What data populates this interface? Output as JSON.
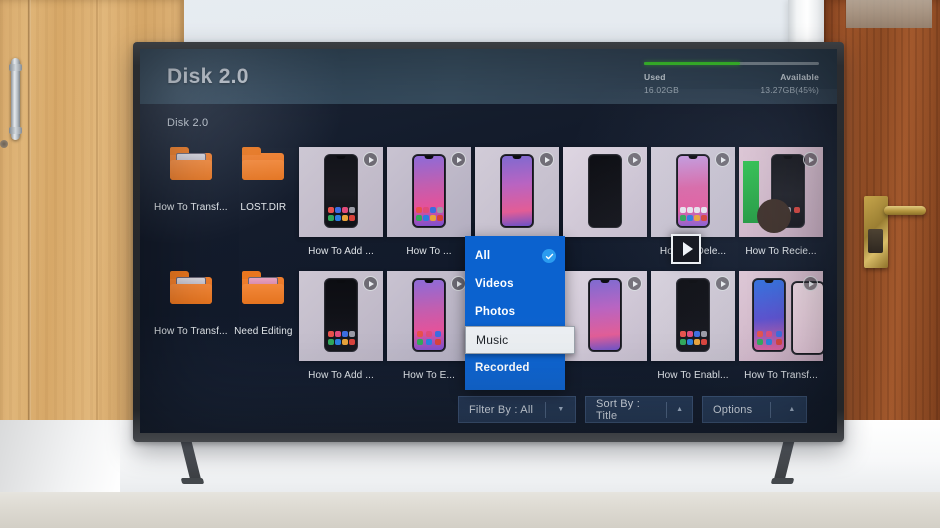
{
  "scene": {
    "description": "television-displaying-file-manager",
    "wall_color": "#e4eaf0",
    "left_door_color": "#dab071",
    "right_door_color": "#8f4c24",
    "table_color": "#f6f7f8",
    "tv_bezel_color": "#2a2c30"
  },
  "app": {
    "header": {
      "title": "Disk 2.0",
      "storage": {
        "used_label": "Used",
        "used_value": "16.02GB",
        "available_label": "Available",
        "available_value": "13.27GB(45%)",
        "fill_percent": 55,
        "fill_color": "#3ec92f",
        "track_color": "#7e8b96"
      }
    },
    "breadcrumb": "Disk 2.0",
    "items": [
      {
        "type": "folder",
        "label": "How To Transf...",
        "preview": "white"
      },
      {
        "type": "folder",
        "label": "LOST.DIR",
        "preview": "none"
      },
      {
        "type": "video",
        "label": "How To Add ...",
        "thumb": "t1",
        "wallpaper": "dark"
      },
      {
        "type": "video",
        "label": "How To ...",
        "thumb": "t2",
        "wallpaper": "grad1"
      },
      {
        "type": "video",
        "label": "",
        "thumb": "t3",
        "wallpaper": "grad3"
      },
      {
        "type": "video",
        "label": "",
        "thumb": "t5",
        "wallpaper": "amoled"
      },
      {
        "type": "video",
        "label": "How To Dele...",
        "thumb": "t3",
        "wallpaper": "grad2"
      },
      {
        "type": "video",
        "label": "How To Recie...",
        "thumb": "t4",
        "wallpaper": "dark"
      },
      {
        "type": "folder",
        "label": "How To Transf...",
        "preview": "white"
      },
      {
        "type": "folder",
        "label": "Need Editing",
        "preview": "pink"
      },
      {
        "type": "video",
        "label": "How To Add ...",
        "thumb": "t1",
        "wallpaper": "amoled"
      },
      {
        "type": "video",
        "label": "How To E...",
        "thumb": "t2",
        "wallpaper": "grad1"
      },
      {
        "type": "video",
        "label": "",
        "thumb": "t6",
        "wallpaper": "dark"
      },
      {
        "type": "video",
        "label": "",
        "thumb": "t5",
        "wallpaper": "grad3"
      },
      {
        "type": "video",
        "label": "How To Enabl...",
        "thumb": "t6",
        "wallpaper": "amoled"
      },
      {
        "type": "video",
        "label": "How To Transf...",
        "thumb": "t4",
        "wallpaper": "bluew"
      }
    ],
    "dropdown": {
      "accent_color": "#0b62cf",
      "highlight_color": "#eceff2",
      "check_color": "#2b9cf0",
      "options": [
        {
          "label": "All",
          "checked": true,
          "highlighted": false
        },
        {
          "label": "Videos",
          "checked": false,
          "highlighted": false
        },
        {
          "label": "Photos",
          "checked": false,
          "highlighted": false
        },
        {
          "label": "Music",
          "checked": false,
          "highlighted": true
        },
        {
          "label": "Recorded",
          "checked": false,
          "highlighted": false
        }
      ]
    },
    "bottom_bar": {
      "filter_by": "Filter By : All",
      "filter_arrow": "▼",
      "sort_by": "Sort By : Title",
      "sort_arrow": "▲",
      "options": "Options",
      "options_arrow": "▲"
    },
    "focus_marker_icon": "play-icon"
  }
}
